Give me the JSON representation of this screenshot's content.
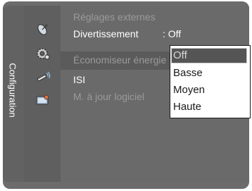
{
  "side_tab": {
    "label": "Configuration"
  },
  "icons": [
    "satellite-dish-icon",
    "gear-settings-icon",
    "remote-signal-icon",
    "support-icon"
  ],
  "menu": {
    "items": [
      {
        "label": "Réglages externes",
        "value": ""
      },
      {
        "label": "Divertissement",
        "value": ": Off"
      },
      {
        "label": "Économiseur énergie",
        "value": ":"
      },
      {
        "label": "ISI",
        "value": ""
      },
      {
        "label": "M. à jour logiciel",
        "value": ""
      }
    ]
  },
  "dropdown": {
    "options": [
      "Off",
      "Basse",
      "Moyen",
      "Haute"
    ],
    "selected": "Off"
  }
}
